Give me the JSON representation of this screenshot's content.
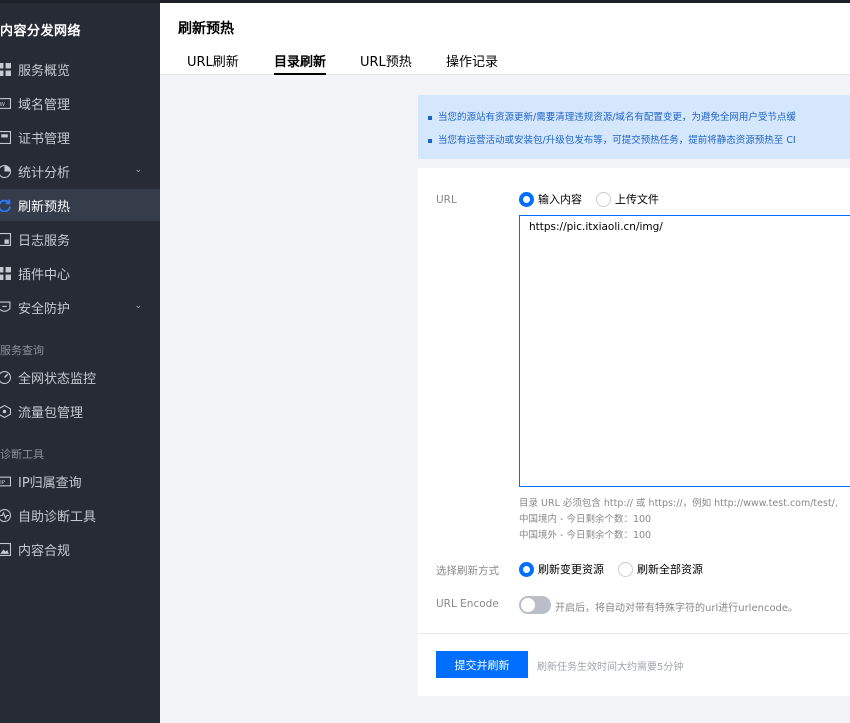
{
  "sidebar": {
    "brand": "内容分发网络",
    "items": [
      {
        "label": "服务概览",
        "icon": "grid-icon"
      },
      {
        "label": "域名管理",
        "icon": "www-icon"
      },
      {
        "label": "证书管理",
        "icon": "certificate-icon"
      },
      {
        "label": "统计分析",
        "icon": "pie-chart-icon",
        "expandable": true
      },
      {
        "label": "刷新预热",
        "icon": "refresh-icon",
        "active": true
      },
      {
        "label": "日志服务",
        "icon": "log-icon"
      },
      {
        "label": "插件中心",
        "icon": "plugin-icon"
      },
      {
        "label": "安全防护",
        "icon": "shield-icon",
        "expandable": true
      }
    ],
    "group_service": "服务查询",
    "service_items": [
      {
        "label": "全网状态监控",
        "icon": "gauge-icon"
      },
      {
        "label": "流量包管理",
        "icon": "package-icon"
      }
    ],
    "group_diagnose": "诊断工具",
    "diagnose_items": [
      {
        "label": "IP归属查询",
        "icon": "ip-icon"
      },
      {
        "label": "自助诊断工具",
        "icon": "pulse-icon"
      },
      {
        "label": "内容合规",
        "icon": "image-icon"
      }
    ]
  },
  "header": {
    "title": "刷新预热",
    "tabs": [
      {
        "label": "URL刷新"
      },
      {
        "label": "目录刷新",
        "active": true
      },
      {
        "label": "URL预热"
      },
      {
        "label": "操作记录"
      }
    ]
  },
  "notice": {
    "line1": "当您的源站有资源更新/需要清理违规资源/域名有配置变更，为避免全网用户受节点缓",
    "line2": "当您有运营活动或安装包/升级包发布等，可提交预热任务，提前将静态资源预热至 CI"
  },
  "form": {
    "url_label": "URL",
    "input_mode": {
      "options": [
        "输入内容",
        "上传文件"
      ],
      "selected": "输入内容"
    },
    "textarea_value": "https://pic.itxiaoli.cn/img/",
    "hint_line1": "目录 URL 必须包含 http:// 或 https://，例如 http://www.test.com/test/,",
    "hint_line2": "中国境内 - 今日剩余个数：100",
    "hint_line3": "中国境外 - 今日剩余个数：100",
    "refresh_mode_label": "选择刷新方式",
    "refresh_mode": {
      "options": [
        "刷新变更资源",
        "刷新全部资源"
      ],
      "selected": "刷新变更资源"
    },
    "url_encode_label": "URL Encode",
    "url_encode_on": false,
    "url_encode_desc": "开启后，将自动对带有特殊字符的url进行urlencode。",
    "submit_label": "提交并刷新",
    "submit_hint": "刷新任务生效时间大约需要5分钟"
  },
  "colors": {
    "primary": "#006eff",
    "sidebar_bg": "#262b36",
    "notice_bg": "#d5e7fd"
  }
}
